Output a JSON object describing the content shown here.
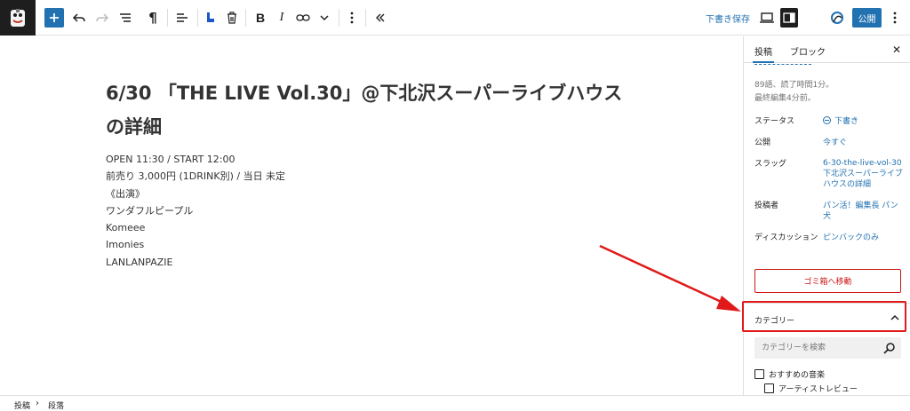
{
  "toolbar": {
    "draft_save_label": "下書き保存",
    "publish_label": "公開"
  },
  "post": {
    "title": "6/30 「THE LIVE Vol.30」@下北沢スーパーライブハウスの詳細",
    "paragraphs": [
      "OPEN 11:30 / START 12:00",
      "前売り 3,000円 (1DRINK別) / 当日 未定",
      "《出演》",
      "ワンダフルピープル",
      "Komeee",
      "Imonies",
      "LANLANPAZIE"
    ]
  },
  "sidebar": {
    "tabs": [
      "投稿",
      "ブロック"
    ],
    "meta_words": "89語、読了時間1分。",
    "meta_edited": "最終編集4分前。",
    "rows": [
      {
        "label": "ステータス",
        "value": "下書き"
      },
      {
        "label": "公開",
        "value": "今すぐ"
      },
      {
        "label": "スラッグ",
        "value": "6-30-the-live-vol-30 下北沢スーパーライブハウスの詳細"
      },
      {
        "label": "投稿者",
        "value": "パン活！編集長 パン犬"
      },
      {
        "label": "ディスカッション",
        "value": "ピンバックのみ"
      }
    ],
    "trash_label": "ゴミ箱へ移動",
    "category": {
      "title": "カテゴリー",
      "search_placeholder": "カテゴリーを検索",
      "items": [
        "おすすめの音楽",
        "アーティストレビュー"
      ]
    }
  },
  "footer": {
    "breadcrumb": [
      "投稿",
      "段落"
    ]
  },
  "colors": {
    "accent": "#2271b1",
    "danger": "#cc1818",
    "annotation": "#e11919"
  }
}
